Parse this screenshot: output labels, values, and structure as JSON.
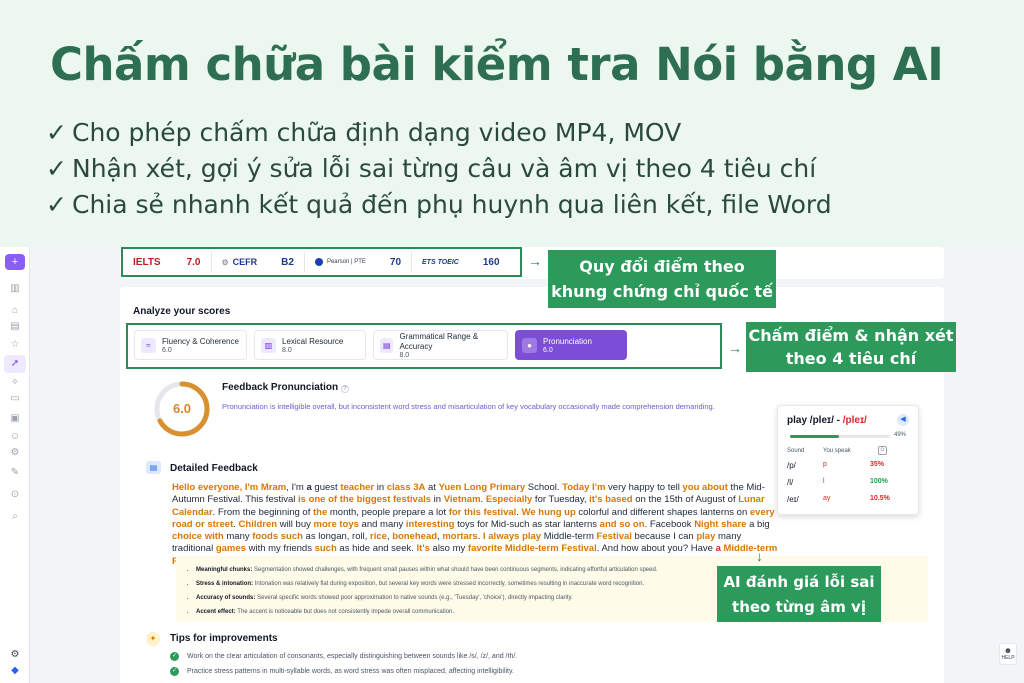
{
  "hero": {
    "title": "Chấm chữa bài kiểm tra Nói bằng AI",
    "bullets": [
      "Cho phép chấm chữa định dạng video MP4, MOV",
      "Nhận xét, gợi ý sửa lỗi sai từng câu và âm vị theo 4 tiêu chí",
      "Chia sẻ nhanh kết quả đến phụ huynh qua liên kết, file Word"
    ],
    "check_glyph": "✓"
  },
  "sidebar": {
    "add_label": "+",
    "icons": [
      "chart-icon",
      "home-icon",
      "document-icon",
      "star-icon",
      "rocket-icon",
      "sparkle-icon",
      "folder-icon",
      "lock-icon",
      "users-icon",
      "gear-icon",
      "pen-icon",
      "settings-icon",
      "search-icon"
    ],
    "active_icon": "rocket-icon",
    "bottom_icons": [
      "settings-icon",
      "logo-icon"
    ]
  },
  "scores": [
    {
      "name": "IELTS",
      "value": "7.0",
      "style": "text"
    },
    {
      "name": "CEFR",
      "value": "B2",
      "style": "logo"
    },
    {
      "name": "Pearson | PTE",
      "value": "70",
      "style": "logo"
    },
    {
      "name": "ETS TOEIC",
      "value": "160",
      "style": "logo"
    }
  ],
  "callouts": {
    "convert": "Quy đổi điểm theo\nkhung chứng chỉ quốc tế",
    "criteria": "Chấm điểm & nhận xét\ntheo 4 tiêu chí",
    "phoneme": "AI đánh giá lỗi sai\ntheo từng âm vị"
  },
  "analyze": {
    "title": "Analyze your scores",
    "tabs": [
      {
        "label": "Fluency & Coherence",
        "score": "6.0",
        "icon": "wave-icon",
        "active": false
      },
      {
        "label": "Lexical Resource",
        "score": "8.0",
        "icon": "book-icon",
        "active": false
      },
      {
        "label": "Grammatical Range & Accuracy",
        "score": "8.0",
        "icon": "document-icon",
        "active": false
      },
      {
        "label": "Pronunciation",
        "score": "6.0",
        "icon": "microphone-icon",
        "active": true
      }
    ]
  },
  "feedback": {
    "score": "6.0",
    "score_fraction": 0.67,
    "title": "Feedback Pronunciation",
    "text": "Pronunciation is intelligible overall, but inconsistent word stress and misarticulation of key vocabulary occasionally made comprehension demanding."
  },
  "pron_popup": {
    "word_prefix": "play /pleɪ/ - ",
    "word_error": "/pleɪ/",
    "percent": "49%",
    "percent_value": 0.49,
    "col_sound": "Sound",
    "col_you": "You speak",
    "rows": [
      {
        "sound": "/p/",
        "you": "p",
        "pct": "35%",
        "color": "#dc2626"
      },
      {
        "sound": "/l/",
        "you": "l",
        "pct": "100%",
        "color": "#16a34a"
      },
      {
        "sound": "/eɪ/",
        "you": "ay",
        "pct": "10.5%",
        "color": "#dc2626"
      }
    ]
  },
  "detailed": {
    "title": "Detailed Feedback",
    "segments": [
      [
        "Hello everyone, I'm Mram",
        "o"
      ],
      [
        ", I'm ",
        ""
      ],
      [
        "a",
        "b"
      ],
      [
        " guest ",
        ""
      ],
      [
        "teacher",
        "o"
      ],
      [
        " in ",
        ""
      ],
      [
        "class 3A",
        "o"
      ],
      [
        " at ",
        ""
      ],
      [
        "Yuen Long Primary",
        "o"
      ],
      [
        " School. ",
        ""
      ],
      [
        "Today I'm",
        "o"
      ],
      [
        " very happy to tell ",
        ""
      ],
      [
        "you about",
        "o"
      ],
      [
        " the Mid-Autumn Festival. This festival ",
        ""
      ],
      [
        "is one of the biggest festivals",
        "o"
      ],
      [
        " in ",
        ""
      ],
      [
        "Vietnam",
        "o"
      ],
      [
        ". ",
        ""
      ],
      [
        "Especially",
        "o"
      ],
      [
        " for Tuesday, ",
        ""
      ],
      [
        "it's based",
        "o"
      ],
      [
        " on the 15th of August of ",
        ""
      ],
      [
        "Lunar Calendar",
        "o"
      ],
      [
        ". From the beginning of ",
        ""
      ],
      [
        "the",
        "o"
      ],
      [
        " month, people prepare a lot ",
        ""
      ],
      [
        "for this festival",
        "o"
      ],
      [
        ". ",
        ""
      ],
      [
        "We hung up",
        "o"
      ],
      [
        " colorful and different shapes lanterns on ",
        ""
      ],
      [
        "every road or street",
        "o"
      ],
      [
        ". ",
        ""
      ],
      [
        "Children",
        "o"
      ],
      [
        " will buy ",
        ""
      ],
      [
        "more toys",
        "o"
      ],
      [
        " and many ",
        ""
      ],
      [
        "interesting",
        "o"
      ],
      [
        " toys for Mid-such as star lanterns ",
        ""
      ],
      [
        "and so on",
        "o"
      ],
      [
        ". Facebook ",
        ""
      ],
      [
        "Night share",
        "o"
      ],
      [
        " a big ",
        ""
      ],
      [
        "choice with",
        "o"
      ],
      [
        " many ",
        ""
      ],
      [
        "foods such",
        "o"
      ],
      [
        " as longan, roll, ",
        ""
      ],
      [
        "rice",
        "o"
      ],
      [
        ", ",
        ""
      ],
      [
        "bonehead",
        "o"
      ],
      [
        ", ",
        ""
      ],
      [
        "mortars",
        "o"
      ],
      [
        ". ",
        ""
      ],
      [
        "I always play",
        "o"
      ],
      [
        " Middle-term ",
        ""
      ],
      [
        "Festival",
        "o"
      ],
      [
        " because I can ",
        ""
      ],
      [
        "play",
        "o"
      ],
      [
        " many traditional ",
        ""
      ],
      [
        "games",
        "o"
      ],
      [
        " with my friends ",
        ""
      ],
      [
        "such",
        "o"
      ],
      [
        " as hide and seek. ",
        ""
      ],
      [
        "It's",
        "o"
      ],
      [
        " also my ",
        ""
      ],
      [
        "favorite Middle-term Festival",
        "o"
      ],
      [
        ". And how about you? Have ",
        ""
      ],
      [
        "a",
        "r"
      ],
      [
        " ",
        ""
      ],
      [
        "Middle-term Festival",
        "o"
      ],
      [
        "?",
        ""
      ]
    ],
    "criteria": [
      {
        "label": "Meaningful chunks:",
        "text": "Segmentation showed challenges, with frequent small pauses within what should have been continuous segments, indicating effortful articulation speed."
      },
      {
        "label": "Stress & intonation:",
        "text": "Intonation was relatively flat during exposition, but several key words were stressed incorrectly, sometimes resulting in inaccurate word recognition."
      },
      {
        "label": "Accuracy of sounds:",
        "text": "Several specific words showed poor approximation to native sounds (e.g., 'Tuesday', 'choice'), directly impacting clarity."
      },
      {
        "label": "Accent effect:",
        "text": "The accent is noticeable but does not consistently impede overall communication."
      }
    ]
  },
  "tips": {
    "title": "Tips for improvements",
    "items": [
      "Work on the clear articulation of consonants, especially distinguishing between sounds like /s/, /z/, and /th/.",
      "Practice stress patterns in multi-syllable words, as word stress was often misplaced, affecting intelligibility."
    ]
  },
  "help_label": "HELP"
}
